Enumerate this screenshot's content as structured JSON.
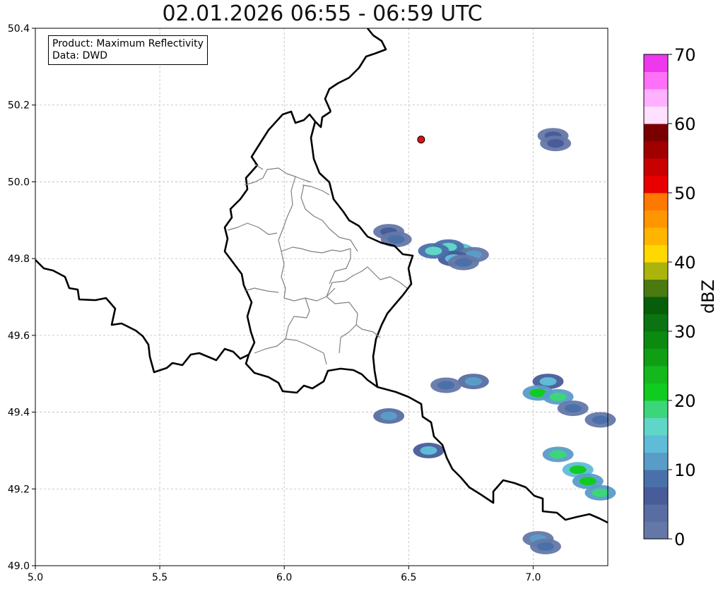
{
  "title": "02.01.2026 06:55 - 06:59 UTC",
  "info": {
    "product_line": "Product: Maximum Reflectivity",
    "data_line": "Data: DWD"
  },
  "axes": {
    "x_ticks": [
      "5.0",
      "5.5",
      "6.0",
      "6.5",
      "7.0"
    ],
    "y_ticks": [
      "50.4",
      "50.2",
      "50.0",
      "49.8",
      "49.6",
      "49.4",
      "49.2",
      "49.0"
    ],
    "lon_range": [
      5.0,
      7.3
    ],
    "lat_range": [
      49.0,
      50.4
    ],
    "grid": true
  },
  "marker": {
    "lon": 6.55,
    "lat": 50.11,
    "color": "#e01010"
  },
  "colorbar": {
    "label": "dBZ",
    "ticks": [
      "0",
      "10",
      "20",
      "30",
      "40",
      "50",
      "60",
      "70"
    ],
    "range": [
      0,
      70
    ],
    "colors": [
      "#6478a8",
      "#586ea2",
      "#485c9a",
      "#4a70aa",
      "#5a9cc8",
      "#5fbcd8",
      "#60d6c8",
      "#3cd67a",
      "#10cc20",
      "#14b81c",
      "#109e14",
      "#0c8a10",
      "#0a7410",
      "#075e0a",
      "#4a7a10",
      "#aab40c",
      "#ffd800",
      "#ffb400",
      "#ff9600",
      "#ff7800",
      "#e80000",
      "#c80000",
      "#a00000",
      "#7a0000",
      "#ffe0ff",
      "#ffb0ff",
      "#ff70f8",
      "#ee38ee"
    ]
  },
  "chart_data": {
    "type": "heatmap",
    "title": "02.01.2026 06:55 - 06:59 UTC",
    "xlim": [
      5.0,
      7.3
    ],
    "ylim": [
      49.0,
      50.4
    ],
    "cells": [
      {
        "lon": 7.08,
        "lat": 50.12,
        "dbz": 5
      },
      {
        "lon": 7.09,
        "lat": 50.1,
        "dbz": 6
      },
      {
        "lon": 6.42,
        "lat": 49.87,
        "dbz": 6
      },
      {
        "lon": 6.45,
        "lat": 49.85,
        "dbz": 8
      },
      {
        "lon": 6.7,
        "lat": 49.82,
        "dbz": 22
      },
      {
        "lon": 6.66,
        "lat": 49.83,
        "dbz": 16
      },
      {
        "lon": 6.76,
        "lat": 49.81,
        "dbz": 10
      },
      {
        "lon": 6.68,
        "lat": 49.8,
        "dbz": 14
      },
      {
        "lon": 6.72,
        "lat": 49.79,
        "dbz": 8
      },
      {
        "lon": 6.6,
        "lat": 49.82,
        "dbz": 16
      },
      {
        "lon": 6.76,
        "lat": 49.48,
        "dbz": 12
      },
      {
        "lon": 6.65,
        "lat": 49.47,
        "dbz": 8
      },
      {
        "lon": 7.06,
        "lat": 49.48,
        "dbz": 14
      },
      {
        "lon": 7.02,
        "lat": 49.45,
        "dbz": 20
      },
      {
        "lon": 7.1,
        "lat": 49.44,
        "dbz": 18
      },
      {
        "lon": 7.16,
        "lat": 49.41,
        "dbz": 8
      },
      {
        "lon": 7.27,
        "lat": 49.38,
        "dbz": 8
      },
      {
        "lon": 6.42,
        "lat": 49.39,
        "dbz": 12
      },
      {
        "lon": 6.58,
        "lat": 49.3,
        "dbz": 14
      },
      {
        "lon": 7.1,
        "lat": 49.29,
        "dbz": 18
      },
      {
        "lon": 7.18,
        "lat": 49.25,
        "dbz": 22
      },
      {
        "lon": 7.22,
        "lat": 49.22,
        "dbz": 20
      },
      {
        "lon": 7.27,
        "lat": 49.19,
        "dbz": 18
      },
      {
        "lon": 7.02,
        "lat": 49.07,
        "dbz": 10
      },
      {
        "lon": 7.05,
        "lat": 49.05,
        "dbz": 8
      }
    ]
  }
}
